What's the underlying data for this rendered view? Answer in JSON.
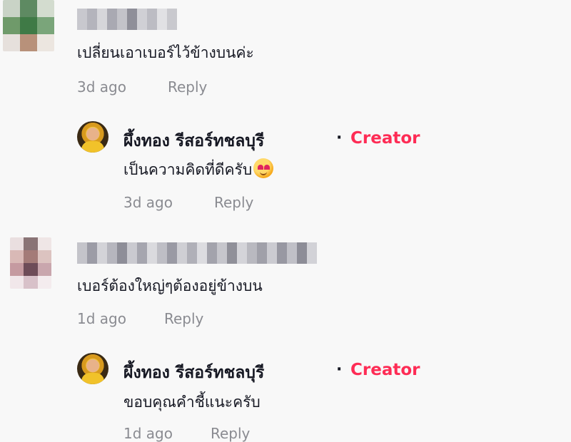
{
  "comments": [
    {
      "text": "เปลี่ยนเอาเบอร์ไว้ข้างบนค่ะ",
      "time": "3d ago",
      "reply_label": "Reply",
      "reply": {
        "author": "ผึ้งทอง รีสอร์ทชลบุรี",
        "separator": "·",
        "badge": "Creator",
        "text": "เป็นความคิดที่ดีครับ",
        "emoji": "smiling-face-with-hearts",
        "time": "3d ago",
        "reply_label": "Reply"
      }
    },
    {
      "text": "เบอร์ต้องใหญ่ๆต้องอยู่ข้างบน",
      "time": "1d ago",
      "reply_label": "Reply",
      "reply": {
        "author": "ผึ้งทอง รีสอร์ทชลบุรี",
        "separator": "·",
        "badge": "Creator",
        "text": "ขอบคุณคำชี้แนะครับ",
        "time": "1d ago",
        "reply_label": "Reply"
      }
    }
  ],
  "colors": {
    "background": "#f8f8f8",
    "text": "#161823",
    "muted": "#8a8b91",
    "creator_badge": "#fe2c55"
  }
}
